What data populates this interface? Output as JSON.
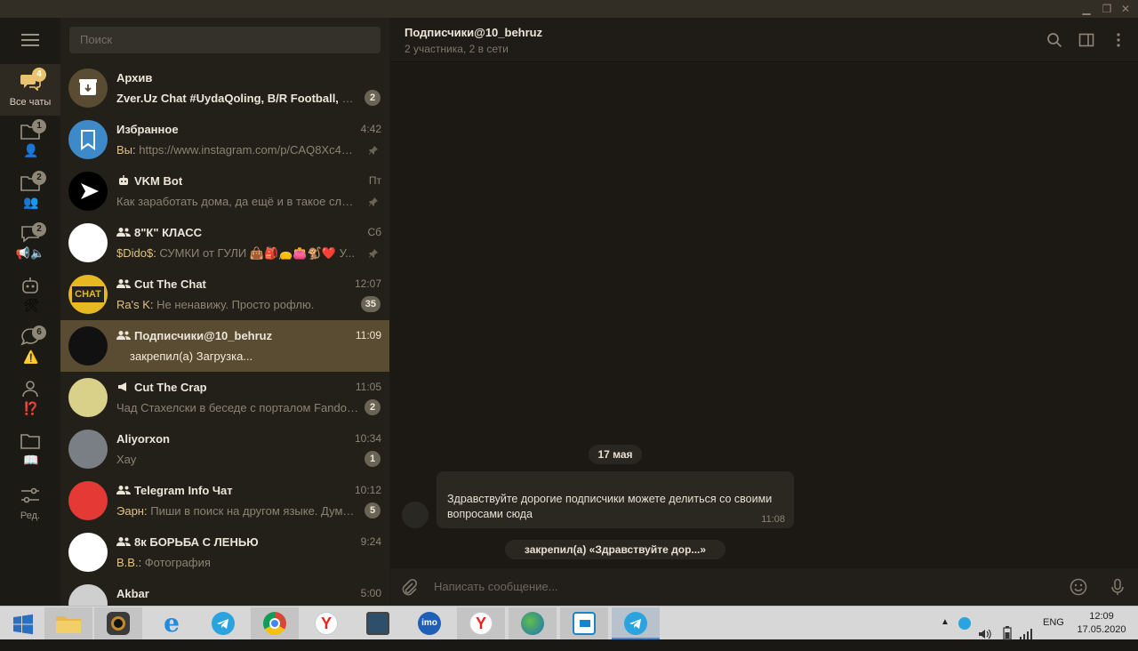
{
  "window": {
    "controls": [
      "minimize",
      "restore",
      "close"
    ]
  },
  "folders": [
    {
      "label": "Все чаты",
      "badge": "4",
      "icon": "chats-icon",
      "active": true
    },
    {
      "label": "",
      "badge": "1",
      "icon": "personal-folder-icon",
      "sub": "👤"
    },
    {
      "label": "",
      "badge": "2",
      "icon": "groups-folder-icon",
      "sub": "👥"
    },
    {
      "label": "",
      "badge": "2",
      "icon": "channels-folder-icon",
      "sub": "📢🔈"
    },
    {
      "label": "",
      "badge": "",
      "icon": "bots-folder-icon",
      "sub": "🛠"
    },
    {
      "label": "",
      "badge": "6",
      "icon": "unread-folder-icon",
      "sub": "⚠️"
    },
    {
      "label": "",
      "badge": "",
      "icon": "contacts-folder-icon",
      "sub": "⁉️"
    },
    {
      "label": "",
      "badge": "",
      "icon": "custom-folder-icon",
      "sub": "📖"
    },
    {
      "label": "Ред.",
      "badge": "",
      "icon": "edit-folders-icon"
    }
  ],
  "search": {
    "placeholder": "Поиск"
  },
  "chats": [
    {
      "name": "Архив",
      "time": "",
      "sender": "",
      "preview": "Zver.Uz Chat #UydaQoling, B/R Football, МОВ...",
      "preview_bold": "Zver.Uz Chat #UydaQoling, B/R Football,",
      "preview_rest": " МОВ...",
      "count": "2",
      "pinned": false,
      "type": "archive",
      "avatar_color": "#5a4c32"
    },
    {
      "name": "Избранное",
      "time": "4:42",
      "sender": "Вы:",
      "preview": " https://www.instagram.com/p/CAQ8Xc4Hb...",
      "count": "",
      "pinned": true,
      "type": "saved",
      "avatar_color": "#3e8ac9"
    },
    {
      "name": "VKM Bot",
      "time": "Пт",
      "sender": "",
      "preview": "Как заработать дома, да ещё и в такое сложн...",
      "count": "",
      "pinned": true,
      "type": "bot",
      "avatar_color": "#000000"
    },
    {
      "name": "8\"К\" КЛАСС",
      "time": "Сб",
      "sender": "$Dido$:",
      "preview": " СУМКИ от ГУЛИ 👜🎒👝👛🐒❤️ У...",
      "count": "",
      "pinned": true,
      "type": "group",
      "avatar_color": "#ffffff"
    },
    {
      "name": "Cut The Chat",
      "time": "12:07",
      "sender": "Ra's K:",
      "preview": " Не ненавижу. Просто рофлю.",
      "count": "35",
      "pinned": false,
      "type": "group",
      "avatar_color": "#e5b91f",
      "avatar_text": "CHAT"
    },
    {
      "name": "Подписчики@10_behruz",
      "time": "11:09",
      "sender": "",
      "preview": "закрепил(а) Загрузка...",
      "count": "",
      "pinned": false,
      "type": "group",
      "avatar_color": "#111111",
      "selected": true
    },
    {
      "name": "Cut The Crap",
      "time": "11:05",
      "sender": "",
      "preview": "Чад Стахелски в беседе с порталом Fandom п...",
      "count": "2",
      "pinned": false,
      "type": "channel",
      "avatar_color": "#d9d08a"
    },
    {
      "name": "Aliyorxon",
      "time": "10:34",
      "sender": "",
      "preview": "Хау",
      "count": "1",
      "pinned": false,
      "type": "user",
      "avatar_color": "#7a7f86"
    },
    {
      "name": "Telegram Info Чат",
      "time": "10:12",
      "sender": "Эарн:",
      "preview": " Пиши в поиск на другом языке. Думаю ...",
      "count": "5",
      "pinned": false,
      "type": "group",
      "avatar_color": "#e53935"
    },
    {
      "name": "8к БОРЬБА С ЛЕНЬЮ",
      "time": "9:24",
      "sender": "В.В.:",
      "preview": " Фотография",
      "count": "",
      "pinned": false,
      "type": "group",
      "avatar_color": "#ffffff"
    },
    {
      "name": "Akbar",
      "time": "5:00",
      "sender": "",
      "preview": "",
      "count": "",
      "pinned": false,
      "type": "user",
      "avatar_color": "#cfcfcf"
    }
  ],
  "header": {
    "title": "Подписчики@10_behruz",
    "status": "2 участника, 2 в сети"
  },
  "messages": {
    "date": "17 мая",
    "bubble_text": "Здравствуйте дорогие подписчики можете делиться со своими вопросами сюда",
    "bubble_time": "11:08",
    "service": "закрепил(а) «Здравствуйте дор...»"
  },
  "composer": {
    "placeholder": "Написать сообщение..."
  },
  "taskbar": {
    "apps": [
      "windows-start",
      "file-explorer",
      "speaker-app",
      "internet-explorer",
      "telegram",
      "chrome",
      "yandex",
      "monitor-app",
      "imo",
      "yandex-browser",
      "download-manager",
      "screen-share",
      "telegram-active"
    ],
    "imo_label": "imo",
    "lang": "ENG",
    "time": "12:09",
    "date": "17.05.2020"
  },
  "colors": {
    "accent": "#e9c36e",
    "selected_row": "#5a4c32",
    "sender": "#e2c184"
  }
}
